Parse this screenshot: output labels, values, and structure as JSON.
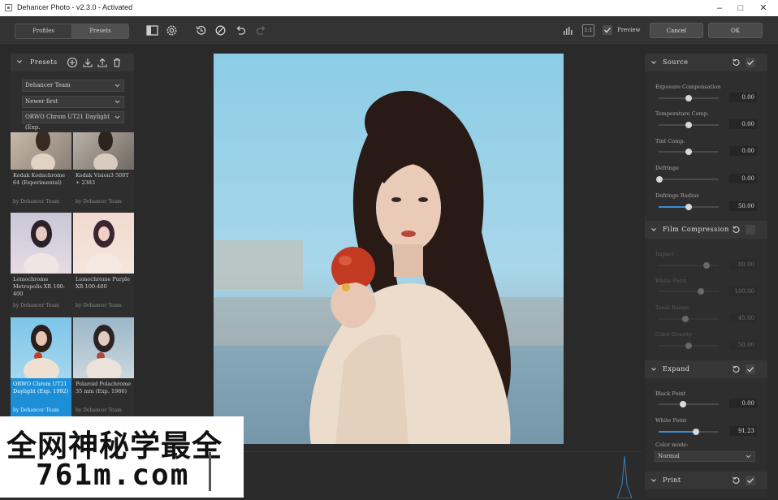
{
  "window": {
    "title": "Dehancer Photo - v2.3.0 - Activated"
  },
  "toolbar": {
    "tab_profiles": "Profiles",
    "tab_presets": "Presets",
    "ratio_label": "1:1",
    "preview_label": "Preview",
    "cancel_label": "Cancel",
    "ok_label": "OK"
  },
  "presets_panel": {
    "title": "Presets",
    "dropdowns": [
      "Dehancer Team",
      "Newer first",
      "ORWO Chrom UT21 Daylight (Exp."
    ],
    "items": [
      {
        "name": "Kodak Kodachrome 64 (Experimental)",
        "author": "by Dehancer Team"
      },
      {
        "name": "Kodak Vision3 500T + 2383",
        "author": "by Dehancer Team"
      },
      {
        "name": "Lomochrome Metropolis XR 100-400",
        "author": "by Dehancer Team"
      },
      {
        "name": "Lomochrome Purple XR 100-400",
        "author": "by Dehancer Team"
      },
      {
        "name": "ORWO Chrom UT21 Daylight (Exp. 1992)",
        "author": "by Dehancer Team"
      },
      {
        "name": "Polaroid Polachrome 35 mm (Exp. 1986)",
        "author": "by Dehancer Team"
      }
    ]
  },
  "right_panel": {
    "source": {
      "title": "Source",
      "params": [
        {
          "label": "Exposure Compensation",
          "value": "0.00",
          "pos": 0.5
        },
        {
          "label": "Temperature Comp.",
          "value": "0.00",
          "pos": 0.5
        },
        {
          "label": "Tint Comp.",
          "value": "0.00",
          "pos": 0.5
        },
        {
          "label": "Defringe",
          "value": "0.00",
          "pos": 0.0
        },
        {
          "label": "Defringe Radius",
          "value": "50.00",
          "pos": 0.5
        }
      ]
    },
    "film_compression": {
      "title": "Film Compression",
      "params": [
        {
          "label": "Impact",
          "value": "80.00",
          "pos": 0.8
        },
        {
          "label": "White Point",
          "value": "100.00",
          "pos": 0.7
        },
        {
          "label": "Tonal Range",
          "value": "45.00",
          "pos": 0.45
        },
        {
          "label": "Color Density",
          "value": "50.00",
          "pos": 0.5
        }
      ]
    },
    "expand": {
      "title": "Expand",
      "params": [
        {
          "label": "Black Point",
          "value": "0.00",
          "pos": 0.4
        },
        {
          "label": "White Point",
          "value": "91.23",
          "pos": 0.62
        }
      ],
      "color_mode_label": "Color mode:",
      "color_mode_value": "Normal"
    },
    "print": {
      "title": "Print"
    }
  },
  "watermark": {
    "line1": "全网神秘学最全",
    "line2": "761m.com"
  }
}
